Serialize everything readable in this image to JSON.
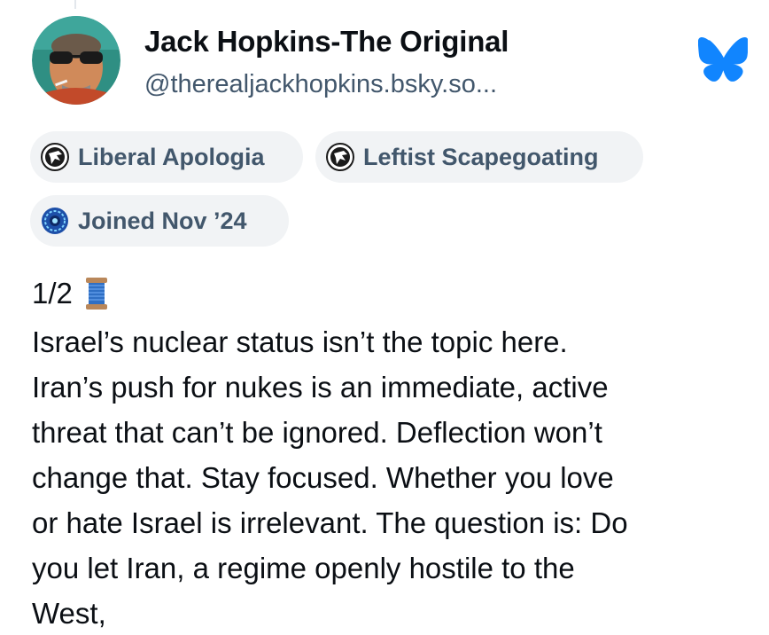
{
  "profile": {
    "display_name": "Jack Hopkins-The Original",
    "handle": "@therealjackhopkins.bsky.so...",
    "avatar_icon": "avatar-photo",
    "platform_icon": "bluesky-butterfly-icon",
    "platform_color": "#1185fe"
  },
  "badges": [
    {
      "label": "Liberal Apologia",
      "icon": "label-emblem-icon"
    },
    {
      "label": "Leftist Scapegoating",
      "icon": "label-emblem-icon"
    },
    {
      "label": "Joined Nov ’24",
      "icon": "joined-badge-icon"
    }
  ],
  "post": {
    "thread_counter": "1/2",
    "thread_emoji": "thread-spool-icon",
    "lines": [
      "Israel’s nuclear status isn’t the topic here.",
      "Iran’s push for nukes is an immediate, active",
      "threat that can’t be ignored. Deflection won’t",
      "change that. Stay focused. Whether you love",
      "or hate Israel is irrelevant. The question is: Do",
      "you let Iran, a regime openly hostile to the",
      "West,"
    ]
  },
  "colors": {
    "text_primary": "#0b0f14",
    "text_secondary": "#42576c",
    "pill_background": "#f1f3f5",
    "accent_blue": "#1185fe"
  }
}
